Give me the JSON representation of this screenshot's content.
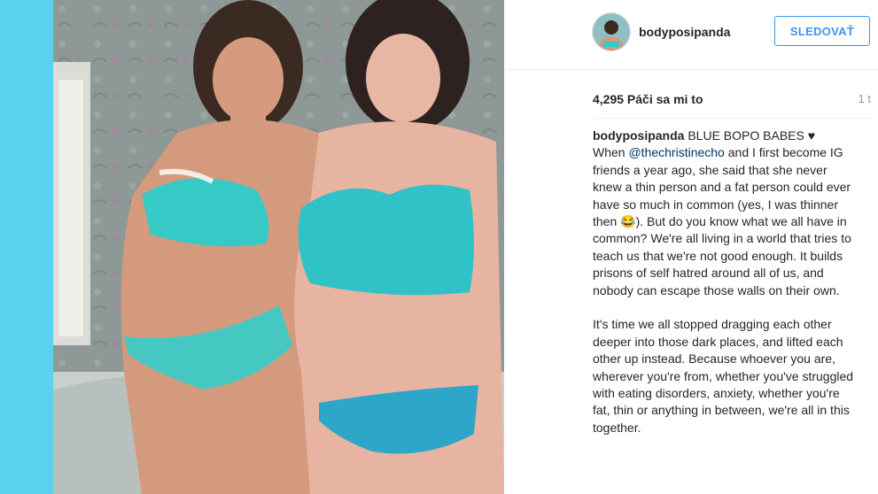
{
  "post": {
    "username": "bodyposipanda",
    "follow_label": "SLEDOVAŤ",
    "likes_text": "4,295 Páči sa mi to",
    "time_label": "1 t",
    "caption": {
      "title": "BLUE BOPO BABES ♥",
      "line_when": "When ",
      "mention": "@thechristinecho",
      "p1_rest": " and I first become IG friends a year ago, she said that she never knew a thin person and a fat person could ever have so much in common (yes, I was thinner then 😂). But do you know what we all have in common? We're all living in a world that tries to teach us that we're not good enough. It builds prisons of self hatred around all of us, and nobody can escape those walls on their own.",
      "p2": "It's time we all stopped dragging each other deeper into those dark places, and lifted each other up instead. Because whoever you are, wherever you're from, whether you've struggled with eating disorders, anxiety, whether you're fat, thin or anything in between, we're all in this together."
    }
  },
  "colors": {
    "backdrop": "#5fd3f0",
    "follow_blue": "#3897f0",
    "mention_blue": "#003569"
  }
}
